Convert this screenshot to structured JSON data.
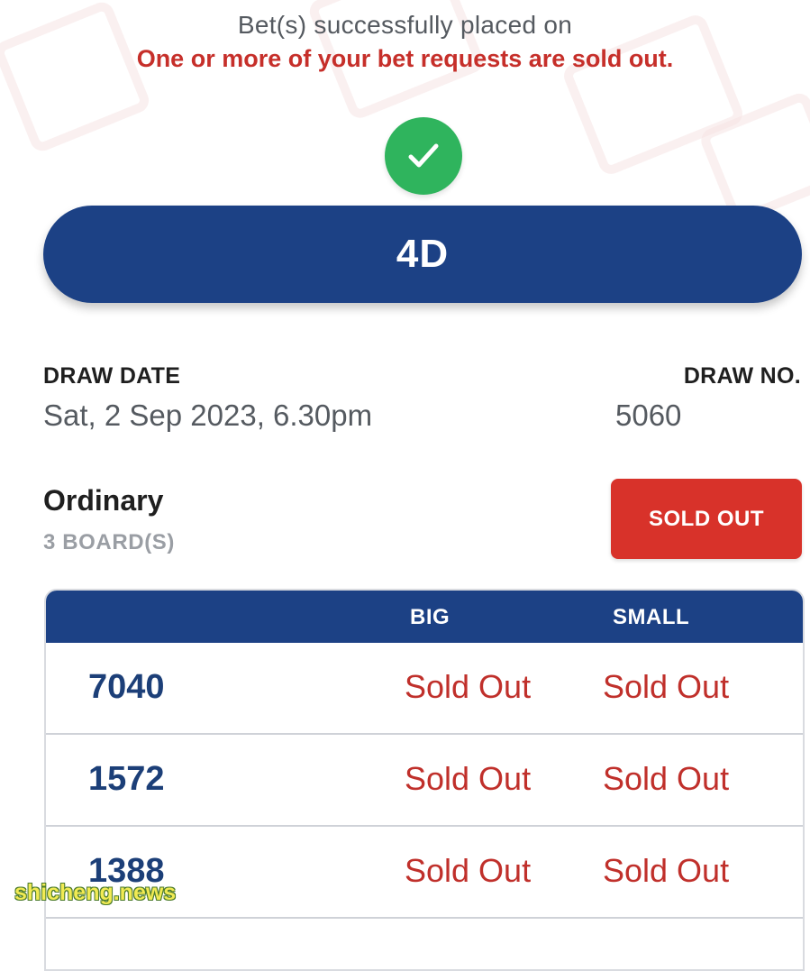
{
  "header": {
    "success_text": "Bet(s) successfully placed on",
    "warning_text": "One or more of your bet requests are sold out."
  },
  "status_icon": "check-icon",
  "game": {
    "name": "4D"
  },
  "draw": {
    "date_label": "DRAW DATE",
    "date_value": "Sat, 2 Sep 2023, 6.30pm",
    "number_label": "DRAW NO.",
    "number_value": "5060"
  },
  "bet": {
    "type": "Ordinary",
    "boards": "3 BOARD(S)",
    "status_button": "SOLD OUT"
  },
  "table": {
    "headers": {
      "number": "",
      "big": "BIG",
      "small": "SMALL"
    },
    "rows": [
      {
        "number": "7040",
        "big": "Sold Out",
        "small": "Sold Out"
      },
      {
        "number": "1572",
        "big": "Sold Out",
        "small": "Sold Out"
      },
      {
        "number": "1388",
        "big": "Sold Out",
        "small": "Sold Out"
      }
    ]
  },
  "watermark": "shicheng.news",
  "colors": {
    "brand_blue": "#1c4185",
    "success_green": "#2fb45d",
    "sold_out_red": "#d8322a",
    "warning_red": "#c62f2a"
  }
}
